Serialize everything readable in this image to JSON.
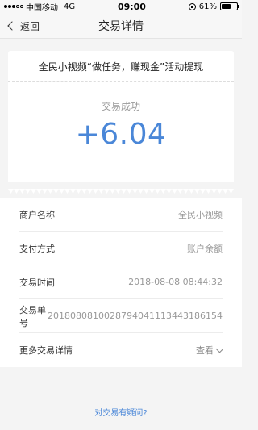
{
  "status_bar": {
    "carrier": "中国移动",
    "network": "4G",
    "time": "09:00",
    "battery_percent": "61%",
    "battery_level": 0.61
  },
  "nav": {
    "back_label": "返回",
    "title": "交易详情"
  },
  "receipt": {
    "title": "全民小视频“做任务，赚现金”活动提现",
    "status": "交易成功",
    "amount": "+6.04",
    "amount_color": "#4a87d8"
  },
  "details": {
    "merchant_label": "商户名称",
    "merchant_value": "全民小视频",
    "payment_label": "支付方式",
    "payment_value": "账户余额",
    "time_label": "交易时间",
    "time_value": "2018-08-08 08:44:32",
    "order_label": "交易单号",
    "order_value": "2018080810028794041113443186154",
    "more_label": "更多交易详情",
    "more_action": "查看"
  },
  "footer": {
    "question_link": "对交易有疑问?"
  }
}
